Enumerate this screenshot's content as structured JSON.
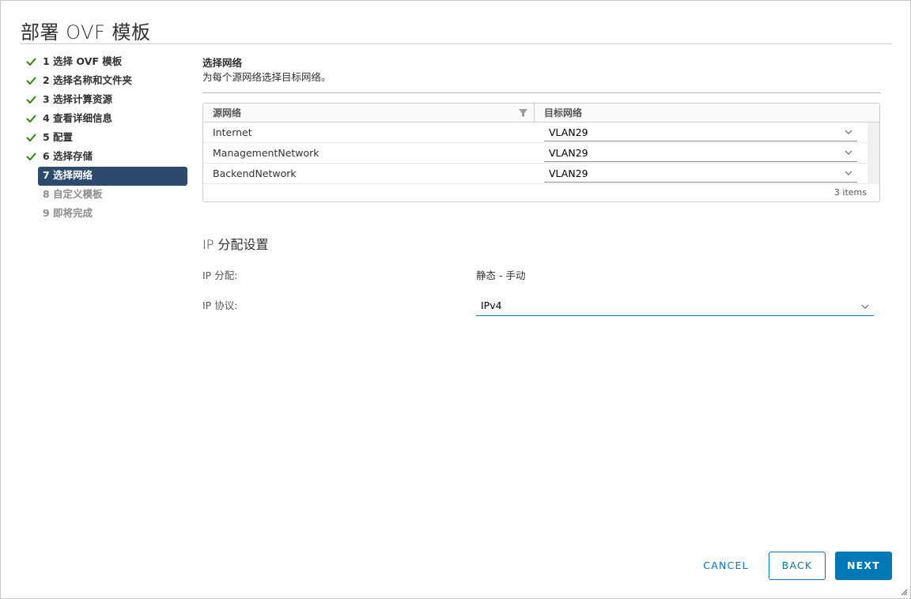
{
  "dialog": {
    "title": "部署 OVF 模板"
  },
  "steps": [
    {
      "label": "1 选择 OVF 模板",
      "state": "done"
    },
    {
      "label": "2 选择名称和文件夹",
      "state": "done"
    },
    {
      "label": "3 选择计算资源",
      "state": "done"
    },
    {
      "label": "4 查看详细信息",
      "state": "done"
    },
    {
      "label": "5 配置",
      "state": "done"
    },
    {
      "label": "6 选择存储",
      "state": "done"
    },
    {
      "label": "7 选择网络",
      "state": "active"
    },
    {
      "label": "8 自定义模板",
      "state": "pending"
    },
    {
      "label": "9 即将完成",
      "state": "pending"
    }
  ],
  "section": {
    "title": "选择网络",
    "description": "为每个源网络选择目标网络。"
  },
  "grid": {
    "col_source": "源网络",
    "col_target": "目标网络",
    "rows": [
      {
        "source": "Internet",
        "target": "VLAN29"
      },
      {
        "source": "ManagementNetwork",
        "target": "VLAN29"
      },
      {
        "source": "BackendNetwork",
        "target": "VLAN29"
      }
    ],
    "footer": "3 items"
  },
  "ip": {
    "title": "IP 分配设置",
    "alloc_label": "IP 分配:",
    "alloc_value": "静态 - 手动",
    "protocol_label": "IP 协议:",
    "protocol_value": "IPv4"
  },
  "buttons": {
    "cancel": "CANCEL",
    "back": "BACK",
    "next": "NEXT"
  },
  "colors": {
    "accent": "#0079b8",
    "active_step": "#2c4a6e",
    "check": "#2f8400"
  },
  "icons": {
    "done": "check-icon",
    "filter": "filter-icon",
    "dropdown": "chevron-down-icon",
    "resize": "resize-handle-icon"
  }
}
